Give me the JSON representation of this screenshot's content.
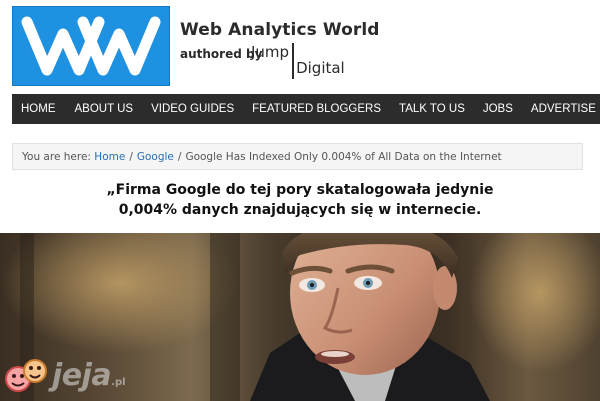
{
  "header": {
    "logo_text": "WW",
    "title": "Web Analytics World",
    "authored_by": "authored by",
    "jump": "Jump",
    "digital": "Digital"
  },
  "nav": {
    "items": [
      {
        "label": "HOME"
      },
      {
        "label": "ABOUT US"
      },
      {
        "label": "VIDEO GUIDES"
      },
      {
        "label": "FEATURED BLOGGERS"
      },
      {
        "label": "TALK TO US"
      },
      {
        "label": "JOBS"
      },
      {
        "label": "ADVERTISE"
      }
    ]
  },
  "breadcrumb": {
    "prefix": "You are here:",
    "home": "Home",
    "separator": "/",
    "google": "Google",
    "current": "Google Has Indexed Only 0.004% of All Data on the Internet"
  },
  "caption": {
    "line1": "„Firma Google do tej pory skatalogowała jedynie",
    "line2": "0,004% danych znajdujących się w internecie."
  },
  "watermark": {
    "text": "jeja",
    "tld": ".pl"
  },
  "colors": {
    "logo_blue": "#1e92e0",
    "nav_bg": "#2c2c2c",
    "link_blue": "#2a6db3"
  }
}
